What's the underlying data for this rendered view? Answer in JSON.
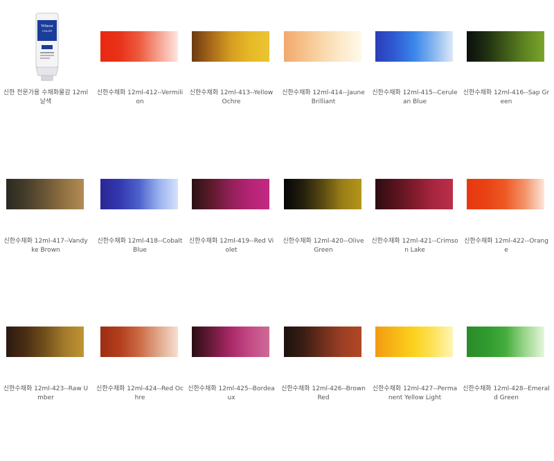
{
  "products": [
    {
      "label": "신한 전문가용 수채화물감 12ml 낱색",
      "kind": "tube",
      "tube": {
        "brand": "Winsor",
        "sub": "COLOR",
        "tube_color": "#1a3d9a"
      }
    },
    {
      "label": "신한수채화 12ml-412--Vermilion",
      "kind": "swatch",
      "colors": [
        "#e8280e",
        "#e8331a",
        "#ed5a3e",
        "#f6a08e",
        "#ffe6df"
      ]
    },
    {
      "label": "신한수채화 12ml-413--Yellow Ochre",
      "kind": "swatch",
      "colors": [
        "#6b3a12",
        "#a9691a",
        "#d49d22",
        "#e7b926",
        "#ecc434"
      ]
    },
    {
      "label": "신한수채화 12ml-414--Jaune Brilliant",
      "kind": "swatch",
      "colors": [
        "#f2a86c",
        "#f6c08a",
        "#f9d8ab",
        "#fcebcc",
        "#fff9ea"
      ]
    },
    {
      "label": "신한수채화 12ml-415--Cerulean Blue",
      "kind": "swatch",
      "colors": [
        "#2b3db6",
        "#2f5bd3",
        "#3a86ea",
        "#86b5ef",
        "#dde9f7"
      ]
    },
    {
      "label": "신한수채화 12ml-416--Sap Green",
      "kind": "swatch",
      "colors": [
        "#0a100c",
        "#1f2e12",
        "#3e5a18",
        "#5f8422",
        "#7ba52a"
      ]
    },
    {
      "label": "신한수채화 12ml-417--Vandyke Brown",
      "kind": "swatch",
      "colors": [
        "#2a2a22",
        "#453d2a",
        "#6a5636",
        "#927242",
        "#b38b55"
      ]
    },
    {
      "label": "신한수채화 12ml-418--Cobalt Blue",
      "kind": "swatch",
      "colors": [
        "#2a2694",
        "#3338b0",
        "#4d62cc",
        "#98b0ee",
        "#d6e2fb"
      ]
    },
    {
      "label": "신한수채화 12ml-419--Red Violet",
      "kind": "swatch",
      "colors": [
        "#2a1214",
        "#5e1a2c",
        "#912058",
        "#b52475",
        "#c32a83"
      ]
    },
    {
      "label": "신한수채화 12ml-420--Olive Green",
      "kind": "swatch",
      "colors": [
        "#050505",
        "#24200e",
        "#5a4a12",
        "#9a7e16",
        "#b5951a"
      ]
    },
    {
      "label": "신한수채화 12ml-421--Crimson Lake",
      "kind": "swatch",
      "colors": [
        "#2f0d12",
        "#55131d",
        "#801b2c",
        "#a8263f",
        "#bb2e4a"
      ]
    },
    {
      "label": "신한수채화 12ml-422--Orange",
      "kind": "swatch",
      "colors": [
        "#e7380f",
        "#ea4214",
        "#ee5a25",
        "#f3936a",
        "#fde5da"
      ]
    },
    {
      "label": "신한수채화 12ml-423--Raw Umber",
      "kind": "swatch",
      "colors": [
        "#2b1a10",
        "#4a2e14",
        "#72501c",
        "#a27a2a",
        "#c09434"
      ]
    },
    {
      "label": "신한수채화 12ml-424--Red Ochre",
      "kind": "swatch",
      "colors": [
        "#9c2e12",
        "#b33e1e",
        "#ca6a44",
        "#e1a78b",
        "#f6dfd2"
      ]
    },
    {
      "label": "신한수채화 12ml-425--Bordeaux",
      "kind": "swatch",
      "colors": [
        "#2a0f14",
        "#6a1a3a",
        "#aa2868",
        "#c44a86",
        "#cd6b96"
      ]
    },
    {
      "label": "신한수채화 12ml-426--Brown Red",
      "kind": "swatch",
      "colors": [
        "#1b110d",
        "#3a1d14",
        "#6e2e1c",
        "#9c3f24",
        "#b14826"
      ]
    },
    {
      "label": "신한수채화 12ml-427--Permanent Yellow Light",
      "kind": "swatch",
      "colors": [
        "#f39a12",
        "#f7b716",
        "#fbd21e",
        "#fde35a",
        "#fff5b8"
      ]
    },
    {
      "label": "신한수채화 12ml-428--Emerald Green",
      "kind": "swatch",
      "colors": [
        "#2b8a2a",
        "#2f9a2e",
        "#45ac3e",
        "#9bd68b",
        "#e6f6de"
      ]
    }
  ]
}
